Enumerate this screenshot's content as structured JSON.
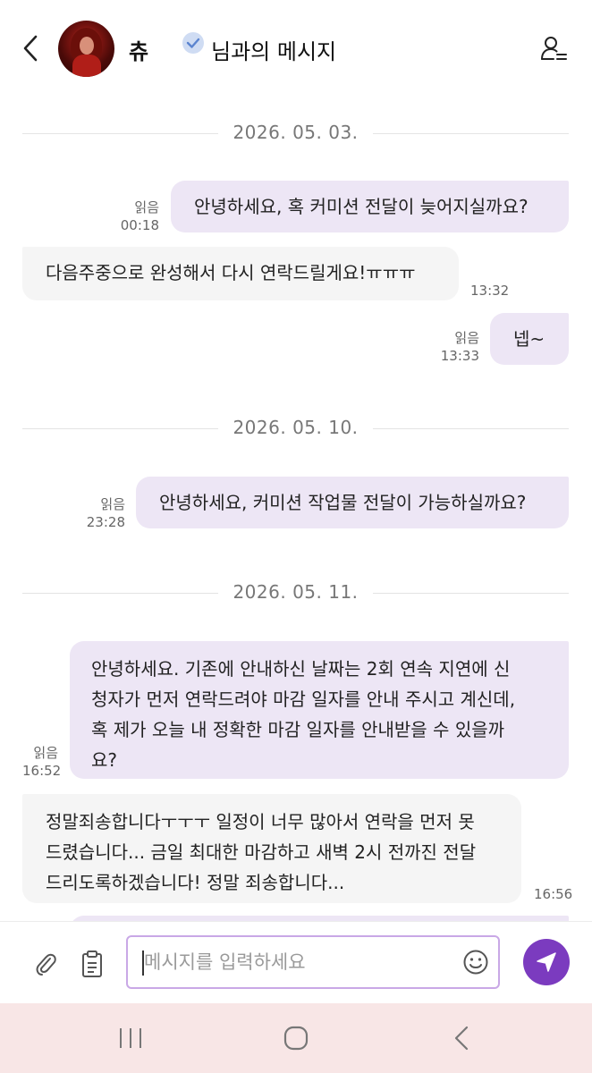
{
  "header": {
    "back_icon": "chevron-left-icon",
    "user_name": "츄",
    "title": "님과의 메시지",
    "verified_icon": "verified-badge-icon",
    "profile_icon": "user-list-icon"
  },
  "dates": [
    "2026. 05. 03.",
    "2026. 05. 10.",
    "2026. 05. 11."
  ],
  "messages": [
    {
      "direction": "out",
      "text": "안녕하세요, 혹 커미션 전달이 늦어지실까요?",
      "read": "읽음",
      "time": "00:18"
    },
    {
      "direction": "in",
      "text": "다음주중으로 완성해서 다시 연락드릴게요!ㅠㅠㅠ",
      "time": "13:32"
    },
    {
      "direction": "out",
      "text": "넵~",
      "read": "읽음",
      "time": "13:33"
    },
    {
      "direction": "out",
      "text": "안녕하세요, 커미션 작업물 전달이 가능하실까요?",
      "read": "읽음",
      "time": "23:28"
    },
    {
      "direction": "out",
      "lines": [
        "안녕하세요. 기존에 안내하신 날짜는 2회 연속 지연에 신",
        "청자가 먼저 연락드려야 마감 일자를 안내 주시고 계신데,",
        "혹 제가 오늘 내 정확한 마감 일자를 안내받을 수 있을까",
        "요?"
      ],
      "read": "읽음",
      "time": "16:52"
    },
    {
      "direction": "in",
      "lines": [
        "정말죄송합니다ㅜㅜㅜ 일정이 너무 많아서 연락을 먼저 못",
        "드렸습니다... 금일 최대한 마감하고 새벽 2시 전까진 전달",
        "드리도록하겠습니다! 정말 죄송합니다..."
      ],
      "time": "16:56"
    }
  ],
  "input": {
    "placeholder": "메시지를 입력하세요",
    "attach_icon": "paperclip-icon",
    "clipboard_icon": "clipboard-icon",
    "emoji_icon": "smiley-icon",
    "send_icon": "send-icon"
  },
  "nav": {
    "recent_icon": "recent-apps-icon",
    "home_icon": "home-icon",
    "back_icon": "back-icon"
  },
  "colors": {
    "outgoing_bubble": "#ede6f5",
    "incoming_bubble": "#f5f5f5",
    "accent": "#7b3bbf",
    "input_border": "#c9a8e6",
    "nav_bar": "#f8e6e6"
  }
}
